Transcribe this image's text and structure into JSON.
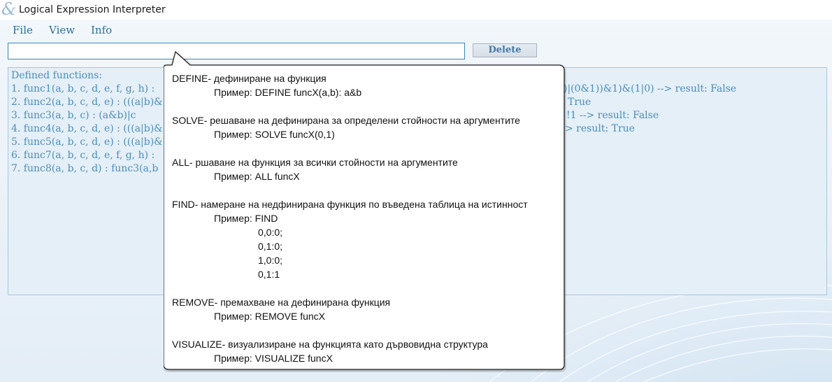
{
  "window": {
    "title": "Logical Expression Interpreter",
    "icon": "ampersand-icon"
  },
  "menu": {
    "file": "File",
    "view": "View",
    "info": "Info"
  },
  "command": {
    "value": "",
    "placeholder": ""
  },
  "toolbar": {
    "delete_label": "Delete"
  },
  "functions_panel": {
    "header": "Defined functions:",
    "items": [
      "1. func1(a, b, c, d, e, f, g, h) :",
      "2. func2(a, b, c, d, e) : (((a|b)&",
      "3. func3(a, b, c) : (a&b)|c",
      "4. func4(a, b, c, d, e) : (((a|b)&",
      "5. func5(a, b, c, d, e) : (((a|b)&",
      "6. func7(a, b, c, d, e, f, g, h) :",
      "7. func8(a, b, c, d) : func3(a,b"
    ],
    "results": [
      ")|(0&1))&1)&(1|0) --> result: False",
      "True",
      "!1 --> result: False",
      "> result: True"
    ]
  },
  "help_tooltip": {
    "define_title": "DEFINE- дефиниране на функция",
    "define_example": "Пример: DEFINE funcX(a,b): a&b",
    "solve_title": "SOLVE- решаване на дефинирана за определени стойности на аргументите",
    "solve_example": "Пример: SOLVE funcX(0,1)",
    "all_title": "ALL- ршаване на  функция за всички стойности на аргументите",
    "all_example": "Пример: ALL funcX",
    "find_title": "FIND- намеране на недфинирана функция по въведена таблица на истинност",
    "find_example": "Пример: FIND",
    "find_rows": [
      "0,0:0;",
      "0,1:0;",
      "1,0:0;",
      "0,1:1"
    ],
    "remove_title": "REMOVE- премахване на дефинирана функция",
    "remove_example": "Пример: REMOVE funcX",
    "visualize_title": "VISUALIZE- визуализиране на функцията като дървовидна структура",
    "visualize_example": "Пример: VISUALIZE funcX"
  },
  "colors": {
    "accent_text": "#4d8cb8",
    "menu_text": "#2d6f98",
    "panel_bg": "#e4eff8",
    "input_border": "#3d83b5"
  }
}
